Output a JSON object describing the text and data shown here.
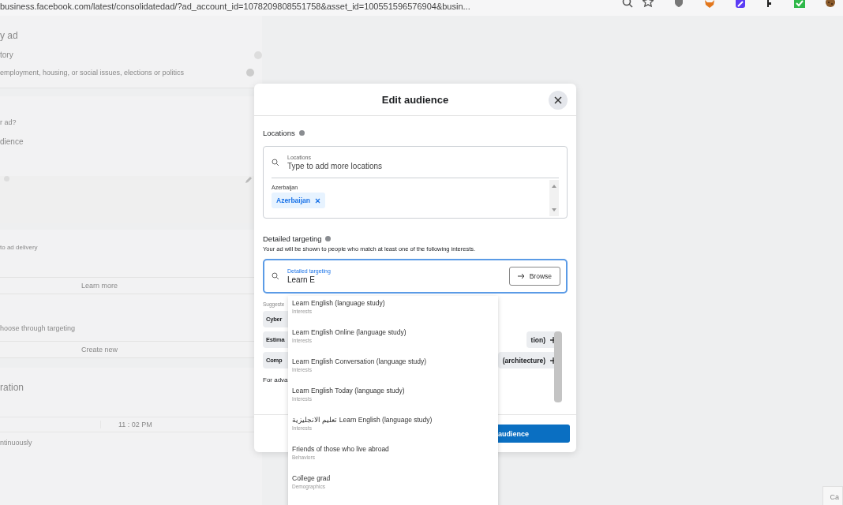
{
  "browser": {
    "url": "business.facebook.com/latest/consolidatedad/?ad_account_id=1078209808551758&asset_id=100551596576904&busin..."
  },
  "background": {
    "title": "y ad",
    "category_label": "tory",
    "category_text": "employment, housing, or social issues, elections or politics",
    "toggle_on": false,
    "question": "r ad?",
    "audience_label": "dience",
    "delivery_label": "to ad delivery",
    "learn_more": "Learn more",
    "targeting_label": "hoose through targeting",
    "create_new": "Create new",
    "duration_label": "ration",
    "time": "11 : 02 PM",
    "schedule_label": "ntinuously",
    "cancel": "Ca"
  },
  "modal": {
    "title": "Edit audience",
    "locations": {
      "label": "Locations",
      "field_label": "Locations",
      "placeholder": "Type to add more locations",
      "group": "Azerbaijan",
      "chips": [
        "Azerbaijan"
      ]
    },
    "detailed": {
      "label": "Detailed targeting",
      "description": "Your ad will be shown to people who match at least one of the following interests.",
      "field_label": "Detailed targeting",
      "value": "Learn E",
      "browse": "Browse",
      "suggested_label": "Suggeste",
      "suggestions": [
        {
          "left": "Cyber"
        },
        {
          "left": "Estima",
          "right": "tion)"
        },
        {
          "left": "Comp",
          "right": "(architecture)"
        }
      ],
      "note": "For adva"
    },
    "primary_button": "audience"
  },
  "dropdown": [
    {
      "title": "Learn English (language study)",
      "category": "Interests"
    },
    {
      "title": "Learn English Online (language study)",
      "category": "Interests"
    },
    {
      "title": "Learn English Conversation (language study)",
      "category": "Interests"
    },
    {
      "title": "Learn English Today (language study)",
      "category": "Interests"
    },
    {
      "title": "تعليم الانجليزية Learn English (language study)",
      "category": "Interests"
    },
    {
      "title": "Friends of those who live abroad",
      "category": "Behaviors"
    },
    {
      "title": "College grad",
      "category": "Demographics"
    }
  ]
}
